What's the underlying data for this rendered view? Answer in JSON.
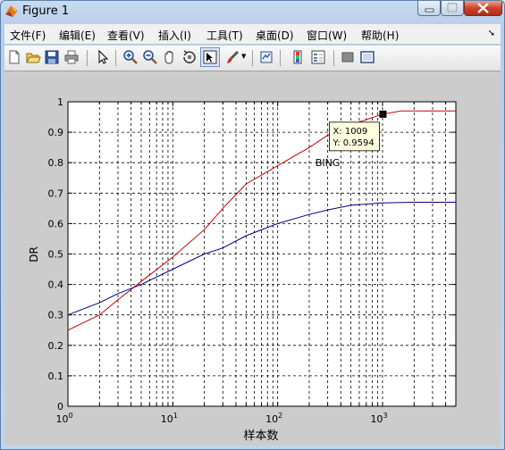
{
  "window": {
    "title": "Figure 1",
    "app_icon": "matlab-icon",
    "controls": [
      "minimize-icon",
      "maximize-icon",
      "close-icon"
    ]
  },
  "menu": [
    "文件(F)",
    "编辑(E)",
    "查看(V)",
    "插入(I)",
    "工具(T)",
    "桌面(D)",
    "窗口(W)",
    "帮助(H)"
  ],
  "toolbar": [
    "new-figure-icon",
    "open-file-icon",
    "save-icon",
    "print-icon",
    "edit-plot-icon",
    "zoom-in-icon",
    "zoom-out-icon",
    "pan-icon",
    "rotate-3d-icon",
    "data-cursor-icon",
    "brush-icon",
    "link-plot-icon",
    "insert-colorbar-icon",
    "insert-legend-icon",
    "hide-plot-tools-icon",
    "show-plot-tools-icon"
  ],
  "chart_data": {
    "type": "line",
    "xlabel": "样本数",
    "ylabel": "DR",
    "xscale": "log",
    "xlim": [
      1,
      5000
    ],
    "ylim": [
      0,
      1
    ],
    "grid": true,
    "x_ticks": [
      {
        "base": "10",
        "exp": "0"
      },
      {
        "base": "10",
        "exp": "1"
      },
      {
        "base": "10",
        "exp": "2"
      },
      {
        "base": "10",
        "exp": "3"
      }
    ],
    "y_ticks": [
      "0",
      "0.1",
      "0.2",
      "0.3",
      "0.4",
      "0.5",
      "0.6",
      "0.7",
      "0.8",
      "0.9",
      "1"
    ],
    "series": [
      {
        "color": "#cc0000",
        "points": [
          [
            1,
            0.25
          ],
          [
            2,
            0.3
          ],
          [
            3,
            0.35
          ],
          [
            5,
            0.41
          ],
          [
            10,
            0.49
          ],
          [
            20,
            0.58
          ],
          [
            30,
            0.65
          ],
          [
            50,
            0.73
          ],
          [
            100,
            0.79
          ],
          [
            200,
            0.85
          ],
          [
            300,
            0.89
          ],
          [
            500,
            0.925
          ],
          [
            1009,
            0.9594
          ],
          [
            1500,
            0.97
          ],
          [
            2000,
            0.97
          ],
          [
            5000,
            0.97
          ]
        ]
      },
      {
        "color": "#000080",
        "points": [
          [
            1,
            0.3
          ],
          [
            2,
            0.34
          ],
          [
            3,
            0.37
          ],
          [
            5,
            0.4
          ],
          [
            10,
            0.45
          ],
          [
            20,
            0.5
          ],
          [
            30,
            0.52
          ],
          [
            50,
            0.56
          ],
          [
            100,
            0.6
          ],
          [
            200,
            0.63
          ],
          [
            300,
            0.645
          ],
          [
            500,
            0.66
          ],
          [
            1000,
            0.668
          ],
          [
            2000,
            0.67
          ],
          [
            5000,
            0.67
          ]
        ]
      }
    ],
    "annotations": [
      {
        "text": "BING",
        "x": 300,
        "y": 0.8
      }
    ],
    "datatip": {
      "x": 1009,
      "y": 0.9594,
      "x_text": "X: 1009",
      "y_text": "Y: 0.9594"
    }
  }
}
